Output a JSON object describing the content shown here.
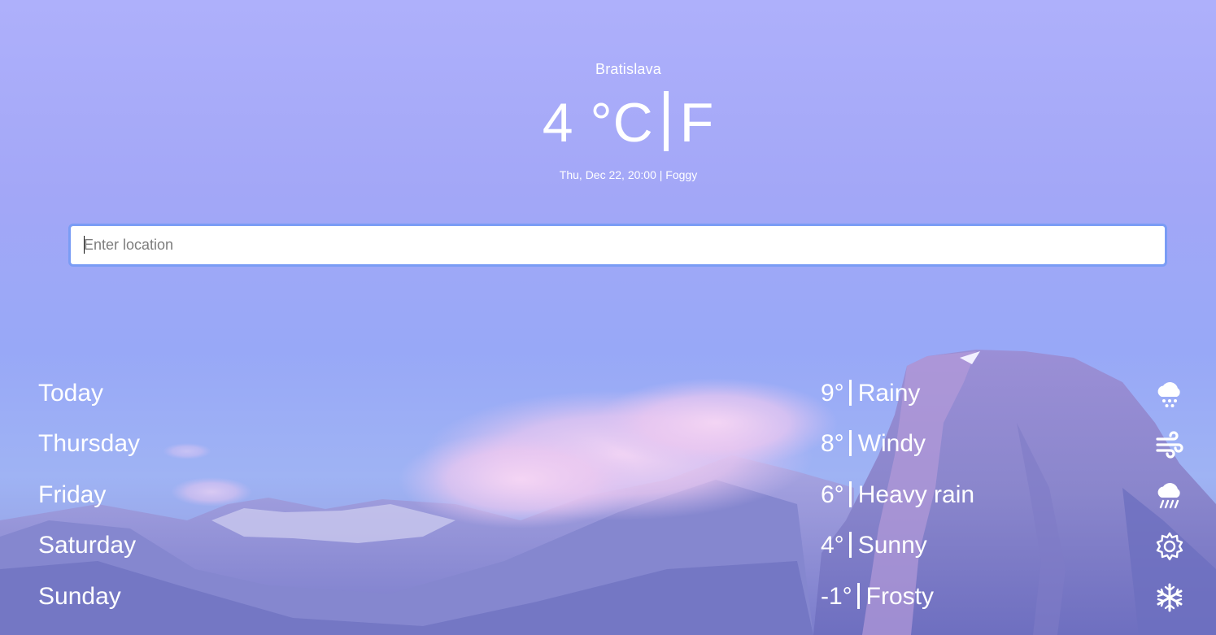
{
  "current": {
    "city": "Bratislava",
    "temperature": "4",
    "unit_celsius": "°C",
    "unit_fahrenheit": "F",
    "meta": "Thu, Dec 22, 20:00 | Foggy"
  },
  "search": {
    "placeholder": "Enter location",
    "value": ""
  },
  "forecast": [
    {
      "day": "Today",
      "temp": "9°",
      "condition": "Rainy",
      "icon": "rain-cloud-icon"
    },
    {
      "day": "Thursday",
      "temp": "8°",
      "condition": "Windy",
      "icon": "wind-icon"
    },
    {
      "day": "Friday",
      "temp": "6°",
      "condition": "Heavy rain",
      "icon": "heavy-rain-icon"
    },
    {
      "day": "Saturday",
      "temp": "4°",
      "condition": "Sunny",
      "icon": "sun-icon"
    },
    {
      "day": "Sunday",
      "temp": "-1°",
      "condition": "Frosty",
      "icon": "snowflake-icon"
    }
  ],
  "colors": {
    "sky_top": "#aeb0fb",
    "sky_mid": "#98a8f7",
    "input_border": "#7a9cf5",
    "text": "#ffffff"
  }
}
